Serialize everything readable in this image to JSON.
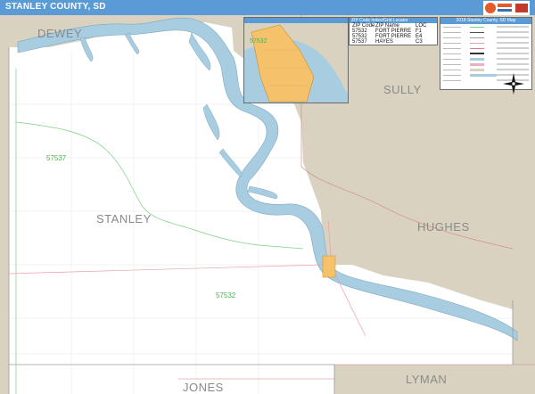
{
  "title": "STANLEY COUNTY, SD",
  "counties": {
    "dewey": "DEWEY",
    "sully": "SULLY",
    "stanley": "STANLEY",
    "hughes": "HUGHES",
    "jones": "JONES",
    "lyman": "LYMAN"
  },
  "zip_labels": {
    "z57537_west": "57537",
    "z57532_south": "57532",
    "z57532_inset": "57532"
  },
  "zip_table": {
    "title": "ZIP Code Index/Grid Locator",
    "headers": [
      "ZIP Code",
      "ZIP Name",
      "LOC"
    ],
    "rows": [
      [
        "57532",
        "FORT PIERRE",
        "F1"
      ],
      [
        "57532",
        "FORT PIERRE",
        "E4"
      ],
      [
        "57537",
        "HAYES",
        "C3"
      ]
    ]
  },
  "legend": {
    "title": "2018 Stanley County, SD Map"
  },
  "colors": {
    "title_bar": "#5b9bd5",
    "land_outside": "#d9d2c1",
    "land_county": "#ffffff",
    "water": "#a8cde0",
    "zip_boundary": "#7fd07f",
    "road": "#e8a0a8",
    "zip_fill": "#f5c26b"
  },
  "icons": {
    "compass": "compass-rose-icon",
    "logo": "publisher-logo-icon"
  }
}
